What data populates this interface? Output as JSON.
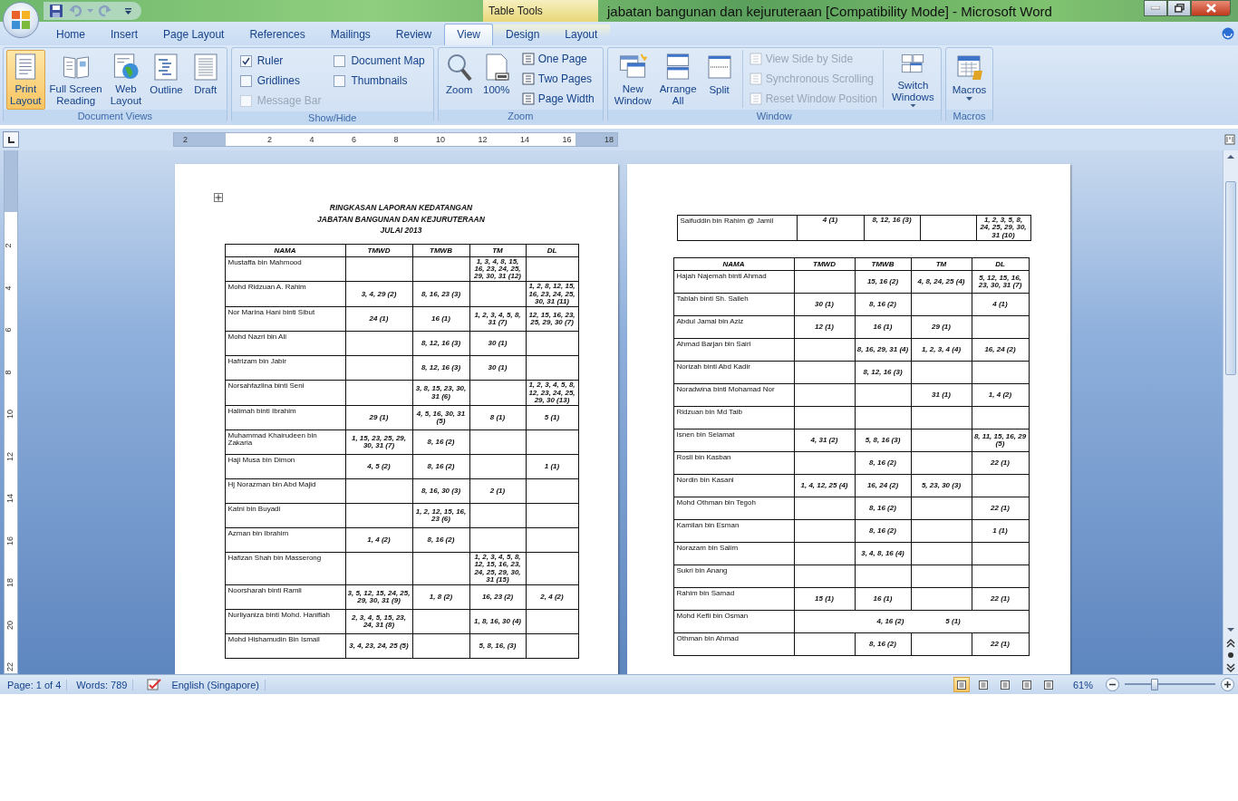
{
  "window": {
    "title": "jabatan bangunan dan kejuruteraan [Compatibility Mode] - Microsoft Word",
    "contextual_group": "Table Tools"
  },
  "tabs": [
    {
      "label": "Home",
      "selected": false,
      "contextual": false
    },
    {
      "label": "Insert",
      "selected": false,
      "contextual": false
    },
    {
      "label": "Page Layout",
      "selected": false,
      "contextual": false
    },
    {
      "label": "References",
      "selected": false,
      "contextual": false
    },
    {
      "label": "Mailings",
      "selected": false,
      "contextual": false
    },
    {
      "label": "Review",
      "selected": false,
      "contextual": false
    },
    {
      "label": "View",
      "selected": true,
      "contextual": false
    },
    {
      "label": "Design",
      "selected": false,
      "contextual": true
    },
    {
      "label": "Layout",
      "selected": false,
      "contextual": true
    }
  ],
  "ribbon": [
    {
      "label": "Document Views",
      "items": [
        {
          "kind": "large",
          "label": "Print\nLayout",
          "selected": true,
          "disabled": false
        },
        {
          "kind": "large",
          "label": "Full Screen\nReading",
          "selected": false,
          "disabled": false
        },
        {
          "kind": "large",
          "label": "Web\nLayout",
          "selected": false,
          "disabled": false
        },
        {
          "kind": "large",
          "label": "Outline",
          "selected": false,
          "disabled": false
        },
        {
          "kind": "large",
          "label": "Draft",
          "selected": false,
          "disabled": false
        }
      ]
    },
    {
      "label": "Show/Hide",
      "items": [
        {
          "kind": "check",
          "label": "Ruler",
          "checked": true,
          "disabled": false
        },
        {
          "kind": "check",
          "label": "Gridlines",
          "checked": false,
          "disabled": false
        },
        {
          "kind": "check",
          "label": "Message Bar",
          "checked": false,
          "disabled": true
        },
        {
          "kind": "check",
          "label": "Document Map",
          "checked": false,
          "disabled": false
        },
        {
          "kind": "check",
          "label": "Thumbnails",
          "checked": false,
          "disabled": false
        }
      ]
    },
    {
      "label": "Zoom",
      "items": [
        {
          "kind": "large",
          "label": "Zoom",
          "selected": false,
          "disabled": false
        },
        {
          "kind": "large",
          "label": "100%",
          "selected": false,
          "disabled": false
        },
        {
          "kind": "small",
          "label": "One Page",
          "disabled": false
        },
        {
          "kind": "small",
          "label": "Two Pages",
          "disabled": false
        },
        {
          "kind": "small",
          "label": "Page Width",
          "disabled": false
        }
      ]
    },
    {
      "label": "Window",
      "items": [
        {
          "kind": "large",
          "label": "New\nWindow",
          "selected": false,
          "disabled": false
        },
        {
          "kind": "large",
          "label": "Arrange\nAll",
          "selected": false,
          "disabled": false
        },
        {
          "kind": "large",
          "label": "Split",
          "selected": false,
          "disabled": false
        },
        {
          "kind": "small",
          "label": "View Side by Side",
          "disabled": true
        },
        {
          "kind": "small",
          "label": "Synchronous Scrolling",
          "disabled": true
        },
        {
          "kind": "small",
          "label": "Reset Window Position",
          "disabled": true
        },
        {
          "kind": "large",
          "label": "Switch\nWindows",
          "selected": false,
          "disabled": false,
          "dropdown": true
        }
      ]
    },
    {
      "label": "Macros",
      "items": [
        {
          "kind": "large",
          "label": "Macros",
          "selected": false,
          "disabled": false,
          "dropdown": true
        }
      ]
    }
  ],
  "ruler": {
    "h_numbers": [
      "2",
      "2",
      "4",
      "6",
      "8",
      "10",
      "12",
      "14",
      "16",
      "18"
    ],
    "v_numbers": [
      "2",
      "4",
      "6",
      "8",
      "10",
      "12",
      "14",
      "16",
      "18",
      "20",
      "22"
    ]
  },
  "left_page": {
    "title_lines": [
      "RINGKASAN LAPORAN KEDATANGAN",
      "JABATAN BANGUNAN DAN KEJURUTERAAN",
      "JULAI  2013"
    ],
    "columns": [
      "NAMA",
      "TMWD",
      "TMWB",
      "TM",
      "DL"
    ],
    "rows": [
      {
        "kind": "normal",
        "name": "Mustaffa bin Mahmood",
        "cells": {
          "tm": "1, 3, 4, 8, 15, 16, 23, 24, 25, 29, 30, 31 (12)"
        }
      },
      {
        "kind": "normal",
        "name": "Mohd Ridzuan A. Rahim",
        "cells": {
          "tmwd": "3, 4, 29 (2)",
          "tmwb": "8, 16, 23 (3)",
          "dl": "1, 2, 8, 12, 15, 16, 23, 24, 25, 30, 31 (11)"
        }
      },
      {
        "kind": "normal",
        "name": "Nor Marina Hani binti Sibut",
        "cells": {
          "tmwd": "24 (1)",
          "tmwb": "16 (1)",
          "tm": "1, 2, 3, 4, 5, 8, 31 (7)",
          "dl": "12, 15, 16, 23, 25, 29, 30 (7)"
        }
      },
      {
        "kind": "normal",
        "name": "Mohd Nazri bin Ali",
        "cells": {
          "tmwb": "8, 12, 16 (3)",
          "tm": "30 (1)"
        }
      },
      {
        "kind": "normal",
        "name": "Hafrizam bin Jabir",
        "cells": {
          "tmwb": "8, 12, 16 (3)",
          "tm": "30 (1)"
        }
      },
      {
        "kind": "normal",
        "name": "Norsahfazlina binti Seni",
        "cells": {
          "tmwb": "3, 8, 15, 23, 30, 31 (6)",
          "dl": "1, 2, 3, 4, 5, 8, 12, 23, 24, 25, 29, 30 (13)"
        }
      },
      {
        "kind": "normal",
        "name": "Halimah binti Ibrahim",
        "cells": {
          "tmwd": "29 (1)",
          "tmwb": "4, 5, 16, 30, 31 (5)",
          "tm": "8 (1)",
          "dl": "5 (1)"
        }
      },
      {
        "kind": "normal",
        "name": "Muhammad Khairudeen bin Zakaria",
        "cells": {
          "tmwd": "1, 15, 23, 25, 29, 30, 31 (7)",
          "tmwb": "8, 16 (2)"
        }
      },
      {
        "kind": "normal",
        "name": "Haji Musa bin Dimon",
        "cells": {
          "tmwd": "4, 5 (2)",
          "tmwb": "8, 16 (2)",
          "dl": "1 (1)"
        }
      },
      {
        "kind": "normal",
        "name": "Hj Norazman  bin Abd Majid",
        "cells": {
          "tmwb": "8, 16, 30 (3)",
          "tm": "2 (1)"
        }
      },
      {
        "kind": "normal",
        "name": "Katni bin Buyadi",
        "cells": {
          "tmwb": "1, 2, 12, 15, 16, 23 (6)"
        }
      },
      {
        "kind": "normal",
        "name": "Azman bin Ibrahim",
        "cells": {
          "tmwd": "1, 4 (2)",
          "tmwb": "8, 16 (2)"
        }
      },
      {
        "kind": "normal",
        "name": "Hafizan Shah bin Masserong",
        "cells": {
          "tm": "1, 2, 3, 4, 5, 8, 12, 15, 16, 23, 24, 25, 29, 30, 31 (15)"
        }
      },
      {
        "kind": "normal",
        "name": "Noorsharah binti Ramli",
        "cells": {
          "tmwd": "3, 5, 12, 15, 24, 25, 29, 30, 31 (9)",
          "tmwb": "1, 8 (2)",
          "tm": "16, 23 (2)",
          "dl": "2, 4 (2)"
        }
      },
      {
        "kind": "normal",
        "name": "Nurliyaniza binti Mohd. Hanifiah",
        "cells": {
          "tmwd": "2, 3, 4, 5, 15, 23, 24, 31 (8)",
          "tm": "1, 8, 16, 30 (4)"
        }
      },
      {
        "kind": "normal",
        "name": "Mohd Hishamudin Bin Ismail",
        "cells": {
          "tmwd": "3, 4, 23, 24, 25 (5)",
          "tm": "5, 8, 16, (3)"
        }
      }
    ]
  },
  "right_page": {
    "continued_rows": [
      {
        "kind": "normal",
        "name": "Saifuddin bin Rahim @  Jamil",
        "cells": {
          "tmwd": "4 (1)",
          "tmwb": "8, 12, 16 (3)",
          "dl": "1, 2, 3, 5, 8, 24, 25, 29, 30, 31 (10)"
        }
      }
    ],
    "columns": [
      "NAMA",
      "TMWD",
      "TMWB",
      "TM",
      "DL"
    ],
    "rows": [
      {
        "kind": "normal",
        "name": "Hajah Najemah  binti  Ahmad",
        "cells": {
          "tmwb": "15, 16 (2)",
          "tm": "4, 8, 24, 25 (4)",
          "dl": "5, 12, 15, 16, 23, 30, 31 (7)"
        }
      },
      {
        "kind": "normal",
        "name": "Tablah binti Sh. Salleh",
        "cells": {
          "tmwd": "30 (1)",
          "tmwb": "8, 16 (2)",
          "dl": "4 (1)"
        }
      },
      {
        "kind": "normal",
        "name": "Abdul Jamal  bin Aziz",
        "cells": {
          "tmwd": "12 (1)",
          "tmwb": "16 (1)",
          "tm": "29 (1)"
        }
      },
      {
        "kind": "normal",
        "name": "Ahmad Barjan bin Sairi",
        "cells": {
          "tmwb": "8, 16, 29, 31 (4)",
          "tm": "1, 2, 3, 4 (4)",
          "dl": "16, 24 (2)"
        }
      },
      {
        "kind": "normal",
        "name": "Norizah binti Abd Kadir",
        "cells": {
          "tmwb": "8, 12, 16 (3)"
        }
      },
      {
        "kind": "normal",
        "name": "Noradwina binti Mohamad Nor",
        "cells": {
          "tm": "31 (1)",
          "dl": "1, 4 (2)"
        }
      },
      {
        "kind": "normal",
        "name": "Ridzuan bin Md Taib",
        "cells": {}
      },
      {
        "kind": "normal",
        "name": "Isnen bin Selamat",
        "cells": {
          "tmwd": "4, 31 (2)",
          "tmwb": "5, 8, 16 (3)",
          "dl": "8, 11, 15, 16, 29 (5)"
        }
      },
      {
        "kind": "normal",
        "name": "Rosli bin Kasban",
        "cells": {
          "tmwb": "8, 16 (2)",
          "dl": "22 (1)"
        }
      },
      {
        "kind": "normal",
        "name": "Nordin bin Kasani",
        "cells": {
          "tmwd": "1, 4, 12, 25 (4)",
          "tmwb": "16, 24 (2)",
          "tm": "5, 23, 30 (3)"
        }
      },
      {
        "kind": "normal",
        "name": "Mohd Othman bin Tegoh",
        "cells": {
          "tmwb": "8, 16 (2)",
          "dl": "22 (1)"
        }
      },
      {
        "kind": "normal",
        "name": "Kamilan bin Esman",
        "cells": {
          "tmwb": "8, 16 (2)",
          "dl": "1 (1)"
        }
      },
      {
        "kind": "normal",
        "name": "Norazam bin Salim",
        "cells": {
          "tmwb": "3, 4, 8, 16 (4)"
        }
      },
      {
        "kind": "normal",
        "name": "Sukri bin Anang",
        "cells": {}
      },
      {
        "kind": "normal",
        "name": "Rahim bin Samad",
        "cells": {
          "tmwd": "15 (1)",
          "tmwb": "16 (1)",
          "dl": "22 (1)"
        }
      },
      {
        "kind": "merged",
        "name": "Mohd Kefli bin Osman",
        "cells": {
          "tmwb": "4, 16 (2)",
          "tm": "5 (1)"
        }
      },
      {
        "kind": "normal",
        "name": "Othman bin Ahmad",
        "cells": {
          "tmwb": "8, 16 (2)",
          "dl": "22 (1)"
        }
      }
    ]
  },
  "status_bar": {
    "page": "Page: 1 of 4",
    "words": "Words: 789",
    "language": "English (Singapore)",
    "views": [
      {
        "selected": true
      },
      {
        "selected": false
      },
      {
        "selected": false
      },
      {
        "selected": false
      },
      {
        "selected": false
      }
    ],
    "zoom": "61%",
    "zoom_level": {
      "level": 0.33
    }
  }
}
